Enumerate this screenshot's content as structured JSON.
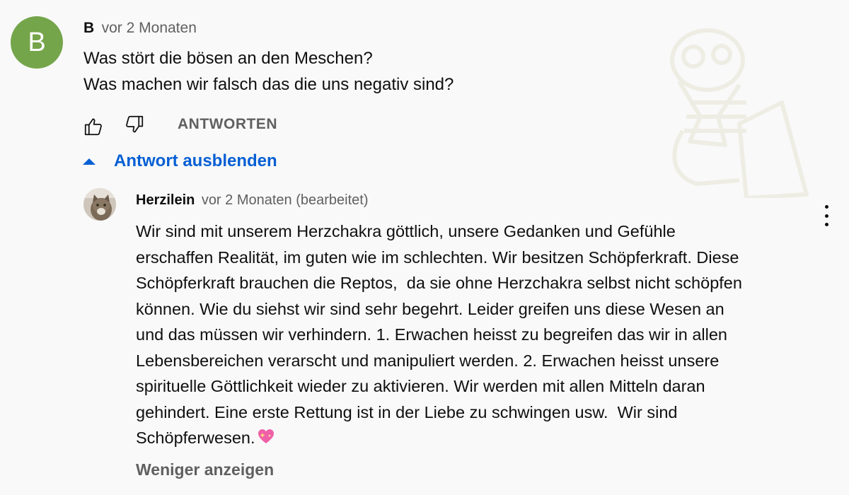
{
  "comment": {
    "avatar_letter": "B",
    "author": "B",
    "time": "vor 2 Monaten",
    "lines": [
      "Was stört die bösen an den Meschen?",
      "Was machen wir falsch das die uns negativ sind?"
    ],
    "like_icon": "thumbs-up-icon",
    "dislike_icon": "thumbs-down-icon",
    "reply_label": "ANTWORTEN",
    "hide_replies_label": "Antwort ausblenden"
  },
  "reply": {
    "author": "Herzilein",
    "time": "vor 2 Monaten (bearbeitet)",
    "lines": [
      "Wir sind mit unserem Herzchakra göttlich, unsere Gedanken und Gefühle",
      "erschaffen Realität, im guten wie im schlechten. Wir besitzen Schöpferkraft. Diese",
      "Schöpferkraft brauchen die Reptos,  da sie ohne Herzchakra selbst nicht schöpfen",
      "können. Wie du siehst wir sind sehr begehrt. Leider greifen uns diese Wesen an",
      "und das müssen wir verhindern. 1. Erwachen heisst zu begreifen das wir in allen",
      "Lebensbereichen verarscht und manipuliert werden. 2. Erwachen heisst unsere",
      "spirituelle Göttlichkeit wieder zu aktivieren. Wir werden mit allen Mitteln daran",
      "gehindert. Eine erste Rettung ist in der Liebe zu schwingen usw.  Wir sind",
      "Schöpferwesen."
    ],
    "emoji_icon": "sparkling-heart-icon",
    "more_icon": "more-vert-icon",
    "show_less_label": "Weniger anzeigen"
  },
  "colors": {
    "avatar_bg": "#75a54a",
    "link_blue": "#065fd4",
    "secondary_text": "#606060"
  }
}
